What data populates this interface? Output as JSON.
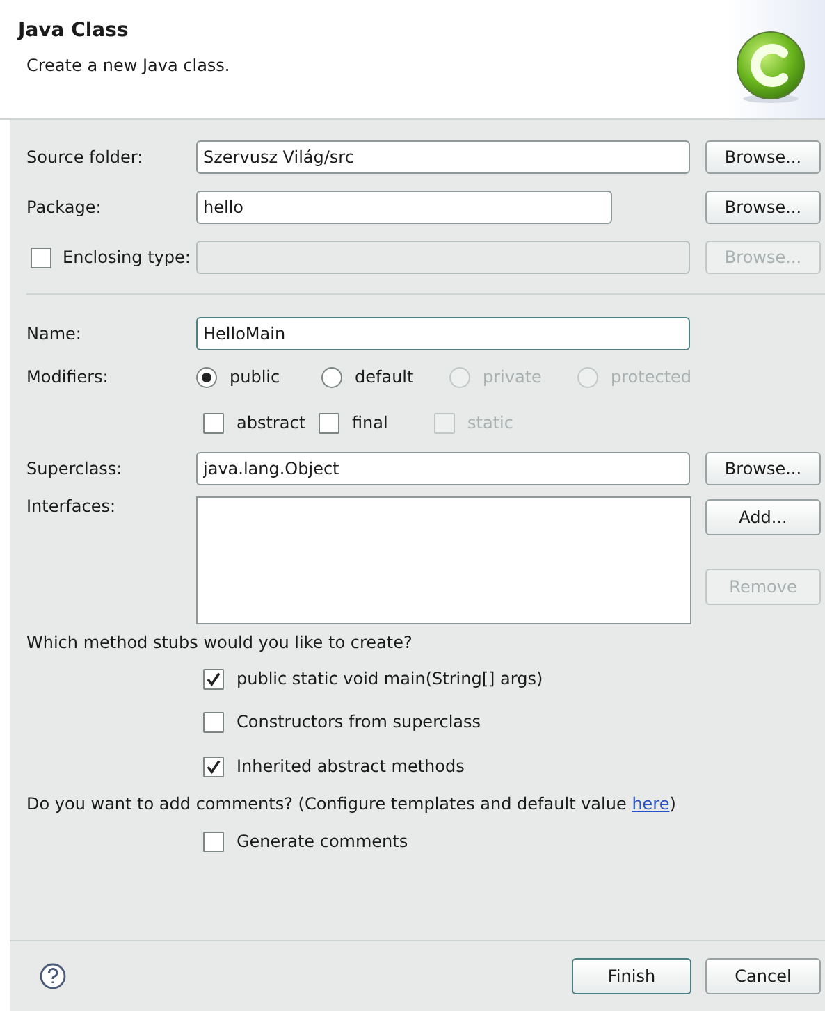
{
  "header": {
    "title": "Java Class",
    "subtitle": "Create a new Java class."
  },
  "source_folder": {
    "label": "Source folder:",
    "value": "Szervusz Világ/src",
    "button": {
      "label": "Browse...",
      "disabled": false
    }
  },
  "package": {
    "label": "Package:",
    "value": "hello",
    "button": {
      "label": "Browse...",
      "disabled": false
    }
  },
  "enclosing_type": {
    "label": "Enclosing type:",
    "checked": false,
    "disabled": true,
    "button": {
      "label": "Browse...",
      "disabled": true
    }
  },
  "name": {
    "label": "Name:",
    "value": "HelloMain",
    "focused": true
  },
  "modifiers": {
    "label": "Modifiers:",
    "access": [
      {
        "label": "public",
        "selected": true,
        "disabled": false
      },
      {
        "label": "default",
        "selected": false,
        "disabled": false
      },
      {
        "label": "private",
        "selected": false,
        "disabled": true
      },
      {
        "label": "protected",
        "selected": false,
        "disabled": true
      }
    ],
    "flags": [
      {
        "label": "abstract",
        "checked": false,
        "disabled": false
      },
      {
        "label": "final",
        "checked": false,
        "disabled": false
      },
      {
        "label": "static",
        "checked": false,
        "disabled": true
      }
    ]
  },
  "superclass": {
    "label": "Superclass:",
    "value": "java.lang.Object",
    "button": {
      "label": "Browse...",
      "disabled": false
    }
  },
  "interfaces": {
    "label": "Interfaces:",
    "buttons": [
      {
        "label": "Add...",
        "disabled": false
      },
      {
        "label": "Remove",
        "disabled": true
      }
    ]
  },
  "method_stubs": {
    "question": "Which method stubs would you like to create?",
    "options": [
      {
        "label": "public static void main(String[] args)",
        "checked": true
      },
      {
        "label": "Constructors from superclass",
        "checked": false
      },
      {
        "label": "Inherited abstract methods",
        "checked": true
      }
    ]
  },
  "comments": {
    "question": "Do you want to add comments? (Configure templates and default value ",
    "link": "here",
    "closing": ")",
    "options": [
      {
        "label": "Generate comments",
        "checked": false
      }
    ]
  },
  "footer": {
    "buttons": [
      {
        "label": "Finish",
        "default": true
      },
      {
        "label": "Cancel",
        "default": false
      }
    ]
  }
}
